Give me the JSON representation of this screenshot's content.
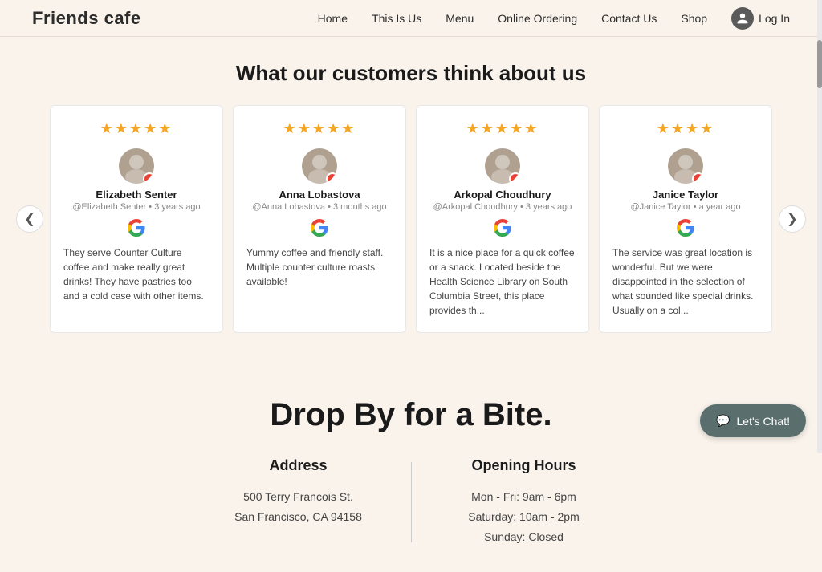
{
  "header": {
    "logo_bold": "Friends",
    "logo_regular": " cafe",
    "nav": {
      "home": "Home",
      "this_is_us": "This Is Us",
      "menu": "Menu",
      "online_ordering": "Online Ordering",
      "contact_us": "Contact Us",
      "shop": "Shop",
      "login": "Log In"
    }
  },
  "reviews_section": {
    "title": "What our customers think about us",
    "prev_arrow": "❮",
    "next_arrow": "❯",
    "reviews": [
      {
        "stars": "★★★★★",
        "name": "Elizabeth Senter",
        "handle": "@Elizabeth Senter",
        "time": "3 years ago",
        "text": "They serve Counter Culture coffee and make really great drinks! They have pastries too and a cold case with other items."
      },
      {
        "stars": "★★★★★",
        "name": "Anna Lobastova",
        "handle": "@Anna Lobastova",
        "time": "3 months ago",
        "text": "Yummy coffee and friendly staff. Multiple counter culture roasts available!"
      },
      {
        "stars": "★★★★★",
        "name": "Arkopal Choudhury",
        "handle": "@Arkopal Choudhury",
        "time": "3 years ago",
        "text": "It is a nice place for a quick coffee or a snack. Located beside the Health Science Library on South Columbia Street, this place provides th..."
      },
      {
        "stars": "★★★★",
        "name": "Janice Taylor",
        "handle": "@Janice Taylor",
        "time": "a year ago",
        "text": "The service was great location is wonderful. But we were disappointed in the selection of what sounded like special drinks. Usually on a col..."
      }
    ]
  },
  "dropby_section": {
    "title": "Drop By for a Bite.",
    "address_heading": "Address",
    "address_line1": "500 Terry Francois St.",
    "address_line2": "San Francisco, CA 94158",
    "hours_heading": "Opening Hours",
    "hours": [
      "Mon - Fri: 9am - 6pm",
      "Saturday: 10am - 2pm",
      "Sunday: Closed"
    ]
  },
  "chat_button": {
    "label": "Let's Chat!"
  }
}
